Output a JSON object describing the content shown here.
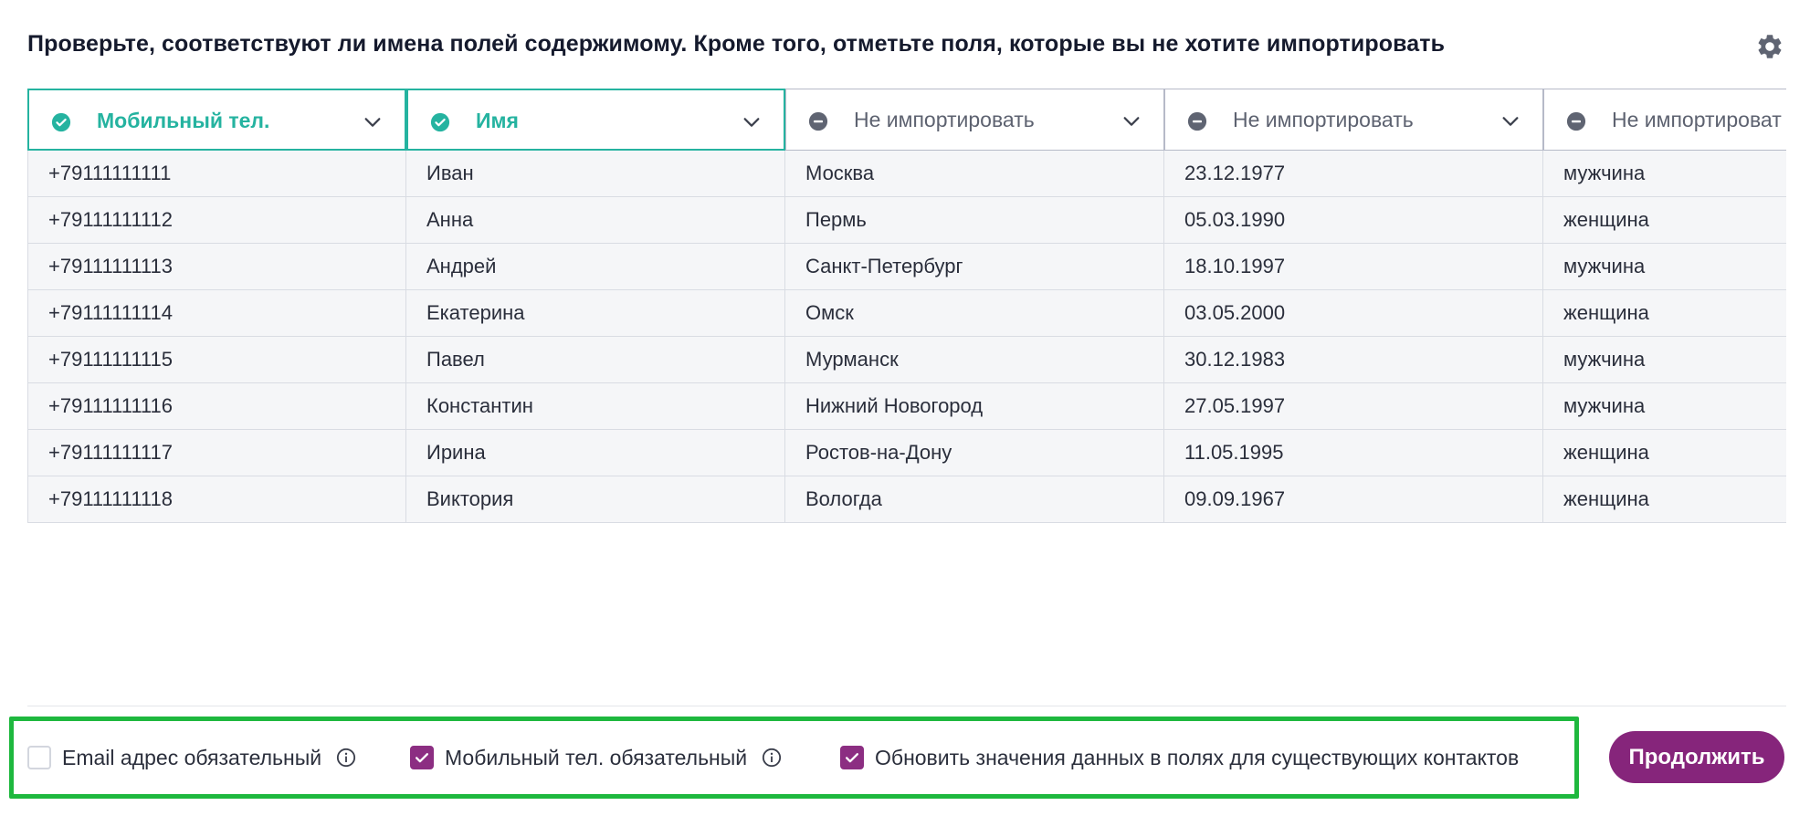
{
  "title": "Проверьте, соответствуют ли имена полей содержимому. Кроме того, отметьте поля, которые вы не хотите импортировать",
  "columns": [
    {
      "label": "Мобильный тел.",
      "status": "mapped"
    },
    {
      "label": "Имя",
      "status": "mapped"
    },
    {
      "label": "Не импортировать",
      "status": "skip"
    },
    {
      "label": "Не импортировать",
      "status": "skip"
    },
    {
      "label": "Не импортироват",
      "status": "skip"
    }
  ],
  "rows": [
    [
      "+79111111111",
      "Иван",
      "Москва",
      "23.12.1977",
      "мужчина"
    ],
    [
      "+79111111112",
      "Анна",
      "Пермь",
      "05.03.1990",
      "женщина"
    ],
    [
      "+79111111113",
      "Андрей",
      "Санкт-Петербург",
      "18.10.1997",
      "мужчина"
    ],
    [
      "+79111111114",
      "Екатерина",
      "Омск",
      "03.05.2000",
      "женщина"
    ],
    [
      "+79111111115",
      "Павел",
      "Мурманск",
      "30.12.1983",
      "мужчина"
    ],
    [
      "+79111111116",
      "Константин",
      "Нижний Новогород",
      "27.05.1997",
      "мужчина"
    ],
    [
      "+79111111117",
      "Ирина",
      "Ростов-на-Дону",
      "11.05.1995",
      "женщина"
    ],
    [
      "+79111111118",
      "Виктория",
      "Вологда",
      "09.09.1967",
      "женщина"
    ]
  ],
  "options": [
    {
      "label": "Email адрес обязательный",
      "checked": false,
      "info": true
    },
    {
      "label": "Мобильный тел. обязательный",
      "checked": true,
      "info": true
    },
    {
      "label": "Обновить значения данных в полях для существующих контактов",
      "checked": true,
      "info": false
    }
  ],
  "continue_label": "Продолжить",
  "colors": {
    "accent_teal": "#25b3a0",
    "brand_purple": "#86257b",
    "highlight_green": "#1eb83e"
  },
  "icons": {
    "settings": "gear-icon",
    "mapped": "check-circle-icon",
    "skip": "minus-circle-icon",
    "dropdown": "chevron-down-icon",
    "info": "info-icon"
  }
}
